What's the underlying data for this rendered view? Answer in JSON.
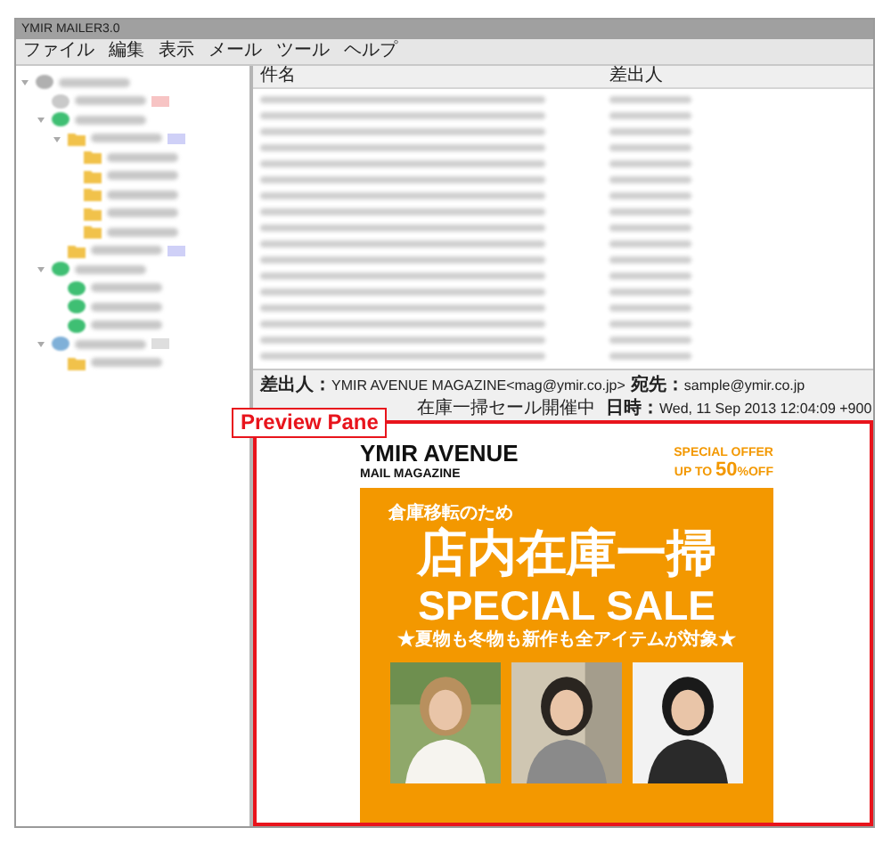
{
  "window": {
    "title": "YMIR MAILER3.0"
  },
  "menu": [
    "ファイル",
    "編集",
    "表示",
    "メール",
    "ツール",
    "ヘルプ"
  ],
  "tree": [
    {
      "kind": "account",
      "children": [
        {
          "kind": "trash",
          "color": "#f7c4c4"
        },
        {
          "kind": "inbox",
          "children": [
            {
              "kind": "folder",
              "color": "#cfd0f7",
              "children": [
                {
                  "kind": "folder"
                },
                {
                  "kind": "folder"
                },
                {
                  "kind": "folder"
                },
                {
                  "kind": "folder"
                },
                {
                  "kind": "folder"
                }
              ]
            },
            {
              "kind": "folder",
              "color": "#cfd0f7"
            }
          ]
        },
        {
          "kind": "inbox",
          "children": [
            {
              "kind": "inbox"
            },
            {
              "kind": "inbox"
            },
            {
              "kind": "inbox"
            }
          ]
        },
        {
          "kind": "box",
          "color": "#dedede",
          "children": [
            {
              "kind": "folder"
            }
          ]
        }
      ]
    }
  ],
  "message_list": {
    "columns": [
      "件名",
      "差出人"
    ],
    "rows": [
      {
        "kind": "blurred"
      },
      {
        "kind": "blurred"
      },
      {
        "kind": "blurred"
      },
      {
        "kind": "blurred"
      },
      {
        "kind": "blurred"
      },
      {
        "kind": "blurred"
      },
      {
        "kind": "blurred"
      },
      {
        "kind": "blurred"
      },
      {
        "kind": "blurred"
      },
      {
        "kind": "blurred"
      },
      {
        "kind": "blurred"
      },
      {
        "kind": "blurred"
      },
      {
        "kind": "blurred"
      },
      {
        "kind": "blurred"
      },
      {
        "kind": "blurred"
      },
      {
        "kind": "blurred"
      },
      {
        "kind": "blurred"
      }
    ]
  },
  "header": {
    "from_label": "差出人：",
    "from": "YMIR AVENUE MAGAZINE<mag@ymir.co.jp>",
    "to_label": "宛先：",
    "to": "sample@ymir.co.jp",
    "subject": "在庫一掃セール開催中",
    "date_label": "日時：",
    "date": "Wed, 11 Sep 2013 12:04:09 +900"
  },
  "callout": "Preview Pane",
  "newsletter": {
    "brand": "YMIR AVENUE",
    "subtitle": "MAIL MAGAZINE",
    "offer": "SPECIAL OFFER",
    "offer_prefix": "UP TO ",
    "offer_number": "50",
    "offer_suffix": "%OFF",
    "kicker": "倉庫移転のため",
    "headline": "店内在庫一掃",
    "sale": "SPECIAL SALE",
    "tagline": "★夏物も冬物も新作も全アイテムが対象★"
  }
}
